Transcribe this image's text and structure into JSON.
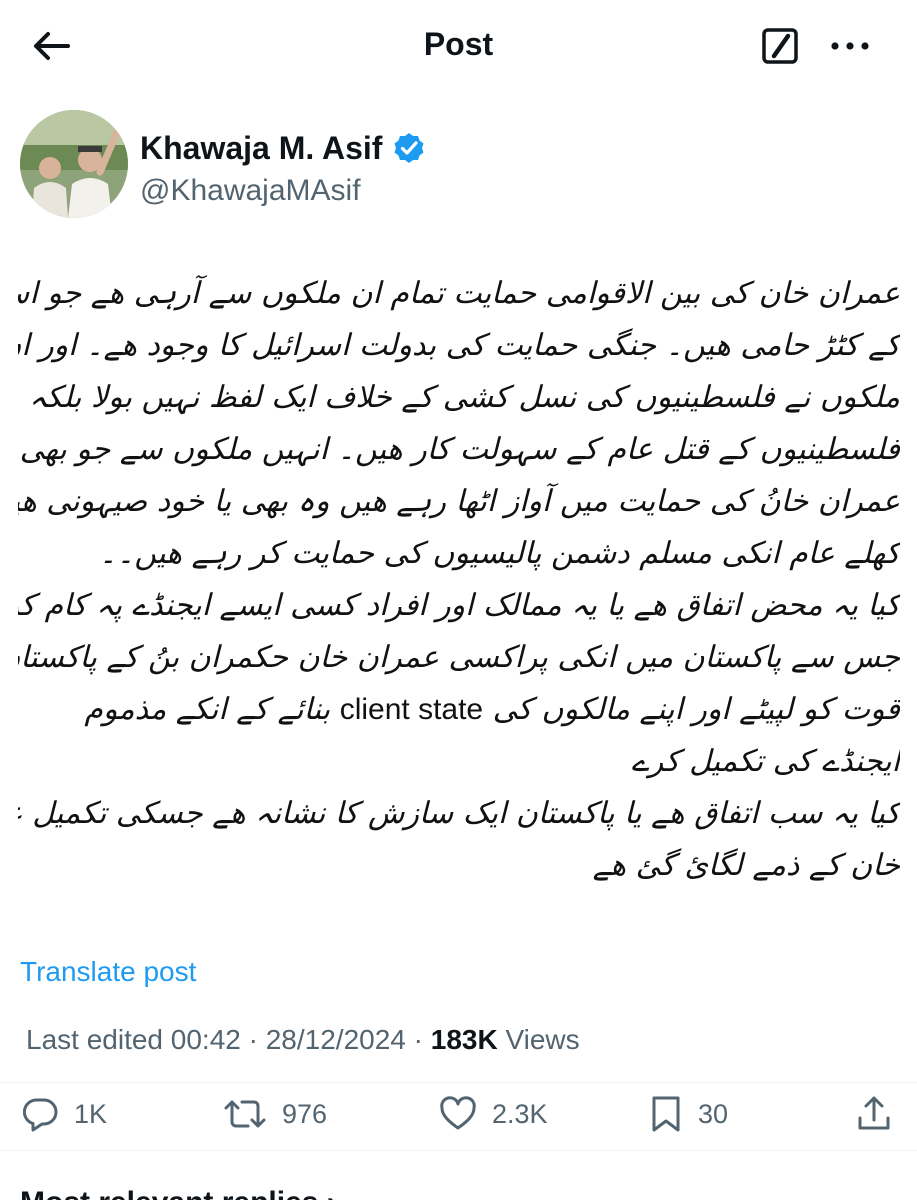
{
  "header": {
    "title": "Post",
    "back_icon": "arrow-left-icon",
    "grok_icon": "slash-box-icon",
    "more_icon": "more-horizontal-icon"
  },
  "author": {
    "name": "Khawaja M. Asif",
    "handle": "@KhawajaMAsif",
    "verified": true,
    "verified_color": "#1d9bf0"
  },
  "post": {
    "lines": [
      "عمران خان کی بین الاقوامی حمایت تمام ان ملکوں سے آرہی ھے جو اسرائیل",
      "کے کٹڑ حامی ھیں۔ جنگی حمایت کی بدولت اسرائیل کا وجود ھے۔ اور ان",
      "ملکوں نے فلسطینیوں کی نسل کشی کے خلاف ایک لفظ نہیں بولا بلکہ",
      "فلسطینیوں کے قتل عام کے سہولت کار ھیں۔ انہیں ملکوں سے جو بھی افراد",
      "عمران خانُ کی حمایت میں آواز اٹھا رہے ھیں وہ بھی یا خود صیہونی ھیں یا",
      "کھلے عام انکی مسلم دشمن پالیسیوں کی حمایت کر رہے ھیں۔۔",
      "کیا یہ محض اتفاق ھے یا یہ ممالک اور افراد کسی ایسے ایجنڈے پہ کام کر رہے",
      "جس سے پاکستان میں انکی پراکسی عمران خان حکمران بنُ کے پاکستان کی ایٹمی",
      "",
      "ایجنڈے کی تکمیل کرے",
      "کیا یہ سب اتفاق ھے یا پاکستان ایک سازش کا نشانہ ھے جسکی تکمیل عمران",
      "خان کے ذمے لگائ گئ ھے"
    ],
    "line9_part1": "قوت کو لپیٹے اور اپنے مالکوں کی",
    "line9_english": "client state",
    "line9_part2": "بنائے کے انکے مذموم"
  },
  "translate_label": "Translate post",
  "meta": {
    "edited_label": "Last edited 00:42 · 28/12/2024 · ",
    "views_count": "183K",
    "views_label": " Views"
  },
  "actions": {
    "reply_icon": "reply-icon",
    "reply_count": "1K",
    "repost_icon": "repost-icon",
    "repost_count": "976",
    "like_icon": "heart-icon",
    "like_count": "2.3K",
    "bookmark_icon": "bookmark-icon",
    "bookmark_count": "30",
    "share_icon": "share-icon"
  },
  "replies_heading": "Most relevant replies ›",
  "colors": {
    "link": "#1d9bf0",
    "muted": "#536471",
    "text": "#0f1419"
  }
}
